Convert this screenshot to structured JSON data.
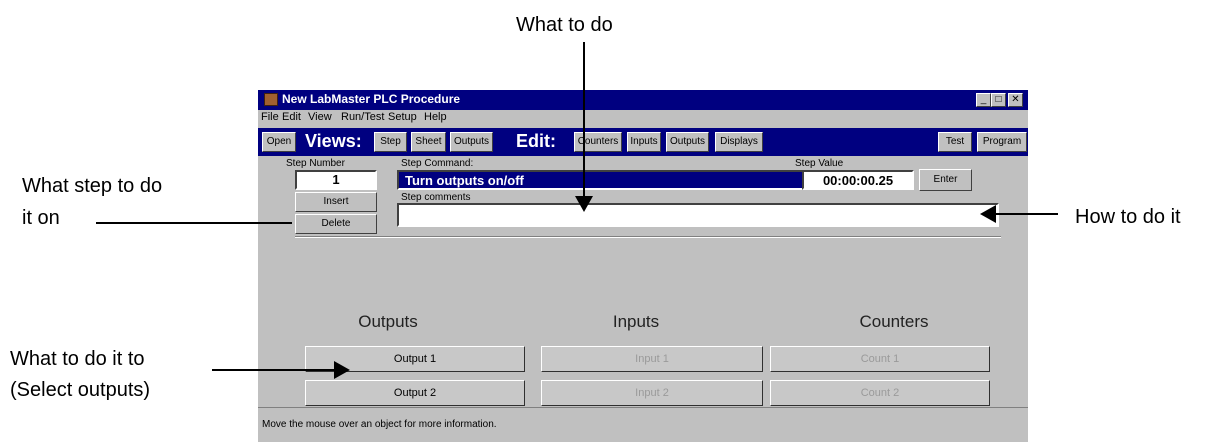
{
  "annotations": {
    "what_to_do": "What to do",
    "step_line1": "What step to do",
    "step_line2": "it on",
    "how": "How to do it",
    "target_line1": "What to do it to",
    "target_line2": "(Select outputs)"
  },
  "window": {
    "title": "New LabMaster PLC Procedure",
    "controls": {
      "minimize": "_",
      "maximize": "□",
      "close": "✕"
    }
  },
  "menu": [
    "File",
    "Edit",
    "View",
    "Run/Test",
    "Setup",
    "Help"
  ],
  "toolbar": {
    "open": "Open",
    "views_label": "Views:",
    "views": [
      "Step",
      "Sheet",
      "Outputs"
    ],
    "edit_label": "Edit:",
    "edit": [
      "Counters",
      "Inputs",
      "Outputs",
      "Displays"
    ],
    "test": "Test",
    "program": "Program"
  },
  "step": {
    "number_label": "Step Number",
    "number": "1",
    "insert": "Insert",
    "delete": "Delete",
    "command_label": "Step Command:",
    "command": "Turn outputs on/off",
    "value_label": "Step Value",
    "value": "00:00:00.25",
    "enter": "Enter",
    "comments_label": "Step comments",
    "comments": ""
  },
  "sections": {
    "outputs": {
      "title": "Outputs",
      "items": [
        "Output 1",
        "Output 2"
      ]
    },
    "inputs": {
      "title": "Inputs",
      "items": [
        "Input 1",
        "Input 2"
      ]
    },
    "counters": {
      "title": "Counters",
      "items": [
        "Count 1",
        "Count 2"
      ]
    }
  },
  "status": "Move the mouse over an object for more information.",
  "colors": {
    "titlebar": "#000080",
    "face": "#c0c0c0",
    "disabled_text": "#9a9a9a"
  }
}
